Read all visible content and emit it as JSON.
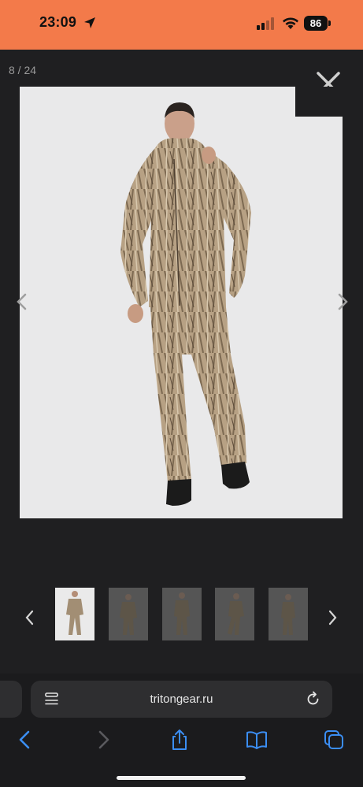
{
  "status_bar": {
    "time": "23:09",
    "battery": "86",
    "background_color": "#f37a4a",
    "icons": [
      "location-arrow-icon",
      "signal-icon",
      "wifi-icon",
      "battery-icon"
    ]
  },
  "gallery": {
    "counter": "8 / 24",
    "icons": [
      "close-icon",
      "chevron-left-icon",
      "chevron-right-icon"
    ],
    "thumbnails": [
      {
        "state": "active"
      },
      {
        "state": "inactive"
      },
      {
        "state": "inactive"
      },
      {
        "state": "inactive"
      },
      {
        "state": "inactive"
      }
    ]
  },
  "browser": {
    "url": "tritongear.ru",
    "toolbar_icons": [
      "back-icon",
      "forward-icon",
      "share-icon",
      "bookmarks-icon",
      "tabs-icon"
    ]
  }
}
